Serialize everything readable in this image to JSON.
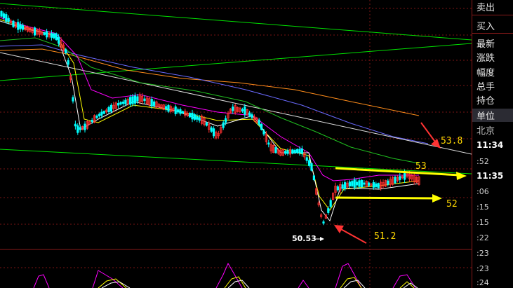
{
  "side_panel": {
    "menu": [
      {
        "label": "卖出",
        "name": "sell-item"
      },
      {
        "label": "买入",
        "name": "buy-item"
      },
      {
        "label": "最新",
        "name": "latest-item"
      },
      {
        "label": "涨跌",
        "name": "change-item"
      },
      {
        "label": "幅度",
        "name": "range-item"
      },
      {
        "label": "总手",
        "name": "volume-item"
      },
      {
        "label": "持仓",
        "name": "position-item"
      },
      {
        "label": "单位",
        "name": "unit-item"
      },
      {
        "label": "北京",
        "name": "beijing-item"
      }
    ],
    "times": [
      {
        "label": "11:34",
        "bold": true
      },
      {
        "label": ":52",
        "bold": false
      },
      {
        "label": "11:35",
        "bold": true
      },
      {
        "label": ":06",
        "bold": false
      },
      {
        "label": ":15",
        "bold": false
      },
      {
        "label": ":15",
        "bold": false
      },
      {
        "label": ":22",
        "bold": false
      },
      {
        "label": ":23",
        "bold": false
      },
      {
        "label": ":23",
        "bold": false
      },
      {
        "label": ":24",
        "bold": false
      }
    ]
  },
  "annotations": {
    "low_price": "50.53",
    "label_538": "53.8",
    "label_53": "53",
    "label_52": "52",
    "label_512": "51.2"
  },
  "colors": {
    "up": "#ff3030",
    "down": "#00ffff",
    "ma_white": "#ffffff",
    "ma_yellow": "#ffff00",
    "ma_magenta": "#ff00ff",
    "ma_green": "#00ff00",
    "ma_orange": "#ff8c1a",
    "ma_blue": "#6a6aff",
    "arrow_yellow": "#ffff00",
    "arrow_red": "#ff3333"
  }
}
